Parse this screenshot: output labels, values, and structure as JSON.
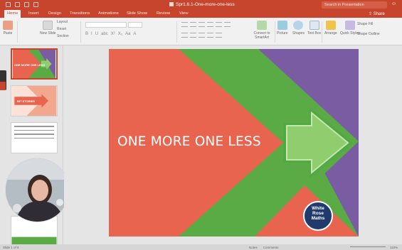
{
  "window": {
    "title": "Spr1.6.1-One-more-one-less",
    "search_placeholder": "Search in Presentation",
    "account_icon": "smiley-icon"
  },
  "tabs": [
    {
      "label": "Home",
      "active": true
    },
    {
      "label": "Insert"
    },
    {
      "label": "Design"
    },
    {
      "label": "Transitions"
    },
    {
      "label": "Animations"
    },
    {
      "label": "Slide Show"
    },
    {
      "label": "Review"
    },
    {
      "label": "View"
    }
  ],
  "share_label": "Share",
  "ribbon": {
    "paste": "Paste",
    "new_slide": "New Slide",
    "layout": "Layout",
    "reset": "Reset",
    "section": "Section",
    "convert_smartart": "Convert to SmartArt",
    "picture": "Picture",
    "shapes": "Shapes",
    "text_box": "Text Box",
    "arrange": "Arrange",
    "quick_styles": "Quick Styles",
    "shape_fill": "Shape Fill",
    "shape_outline": "Shape Outline",
    "format_buttons": [
      "B",
      "I",
      "U",
      "abc",
      "X²",
      "X₂",
      "Aa",
      "A"
    ]
  },
  "thumbnails": [
    {
      "num": "",
      "label": "ONE MORE ONE LESS",
      "selected": true
    },
    {
      "num": "",
      "label": "BIT STORIES"
    },
    {
      "num": "",
      "label": ""
    },
    {
      "num": "",
      "label": ""
    }
  ],
  "slide": {
    "title": "ONE MORE ONE LESS",
    "logo_lines": [
      "White",
      "Rose",
      "Maths"
    ],
    "colors": {
      "coral": "#e8644f",
      "green": "#5aaa46",
      "purple": "#7a5ca3",
      "arrow": "#8fcd6e"
    }
  },
  "status": {
    "left_text": "Slide 1 of 9",
    "notes": "Notes",
    "comments": "Comments",
    "zoom": "110%"
  },
  "colors": {
    "accent": "#c6452c"
  }
}
